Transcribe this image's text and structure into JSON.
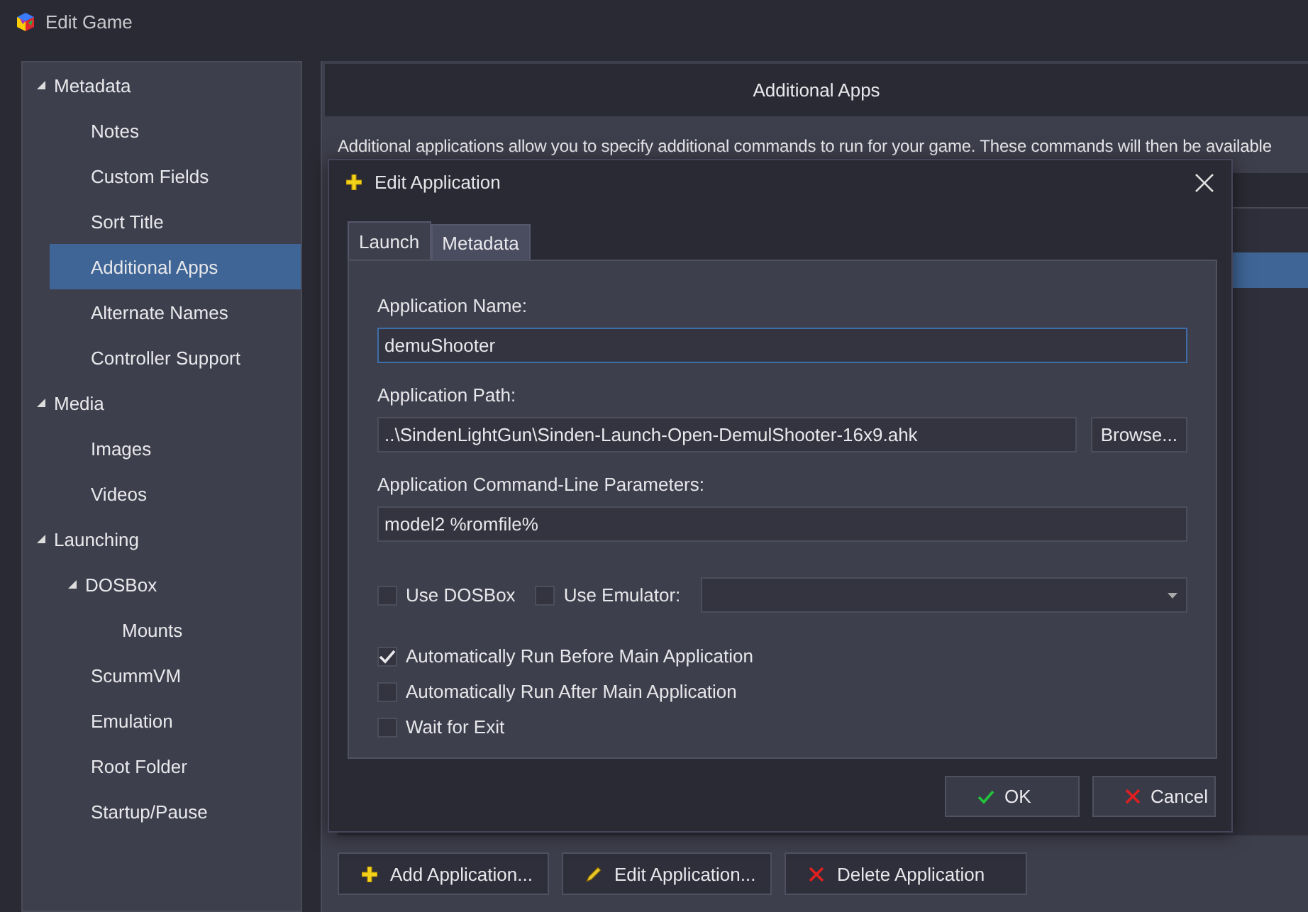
{
  "window": {
    "title": "Edit Game"
  },
  "sidebar": {
    "items": [
      {
        "label": "Metadata",
        "expanded": true,
        "selected": false,
        "children": [
          {
            "label": "Notes",
            "selected": false
          },
          {
            "label": "Custom Fields",
            "selected": false
          },
          {
            "label": "Sort Title",
            "selected": false
          },
          {
            "label": "Additional Apps",
            "selected": true
          },
          {
            "label": "Alternate Names",
            "selected": false
          },
          {
            "label": "Controller Support",
            "selected": false
          }
        ]
      },
      {
        "label": "Media",
        "expanded": true,
        "selected": false,
        "children": [
          {
            "label": "Images",
            "selected": false
          },
          {
            "label": "Videos",
            "selected": false
          }
        ]
      },
      {
        "label": "Launching",
        "expanded": true,
        "selected": false,
        "children": [
          {
            "label": "DOSBox",
            "expanded": true,
            "selected": false,
            "children": [
              {
                "label": "Mounts",
                "selected": false
              }
            ]
          },
          {
            "label": "ScummVM",
            "selected": false
          },
          {
            "label": "Emulation",
            "selected": false
          },
          {
            "label": "Root Folder",
            "selected": false
          },
          {
            "label": "Startup/Pause",
            "selected": false
          }
        ]
      }
    ]
  },
  "panel": {
    "title": "Additional Apps",
    "description": "Additional applications allow you to specify additional commands to run for your game.  These commands will then be available",
    "buttons": [
      {
        "label": "Add Application...",
        "kind": "add"
      },
      {
        "label": "Edit Application...",
        "kind": "edit"
      },
      {
        "label": "Delete Application",
        "kind": "delete"
      }
    ]
  },
  "dialog": {
    "title": "Edit Application",
    "tabs": [
      {
        "label": "Launch",
        "selected": true
      },
      {
        "label": "Metadata",
        "selected": false
      }
    ],
    "name": {
      "label": "Application Name:",
      "value": "demuShooter"
    },
    "path": {
      "label": "Application Path:",
      "value": "..\\SindenLightGun\\Sinden-Launch-Open-DemulShooter-16x9.ahk",
      "button": "Browse..."
    },
    "params": {
      "label": "Application Command-Line Parameters:",
      "value": "model2 %romfile%"
    },
    "use_dosbox": {
      "label": "Use DOSBox",
      "checked": false
    },
    "use_emulator": {
      "label": "Use Emulator:",
      "checked": false
    },
    "options": [
      {
        "label": "Automatically Run Before Main Application",
        "checked": true
      },
      {
        "label": "Automatically Run After Main Application",
        "checked": false
      },
      {
        "label": "Wait for Exit",
        "checked": false
      }
    ],
    "buttons": [
      {
        "label": "OK",
        "kind": "ok"
      },
      {
        "label": "Cancel",
        "kind": "cancel"
      }
    ]
  }
}
